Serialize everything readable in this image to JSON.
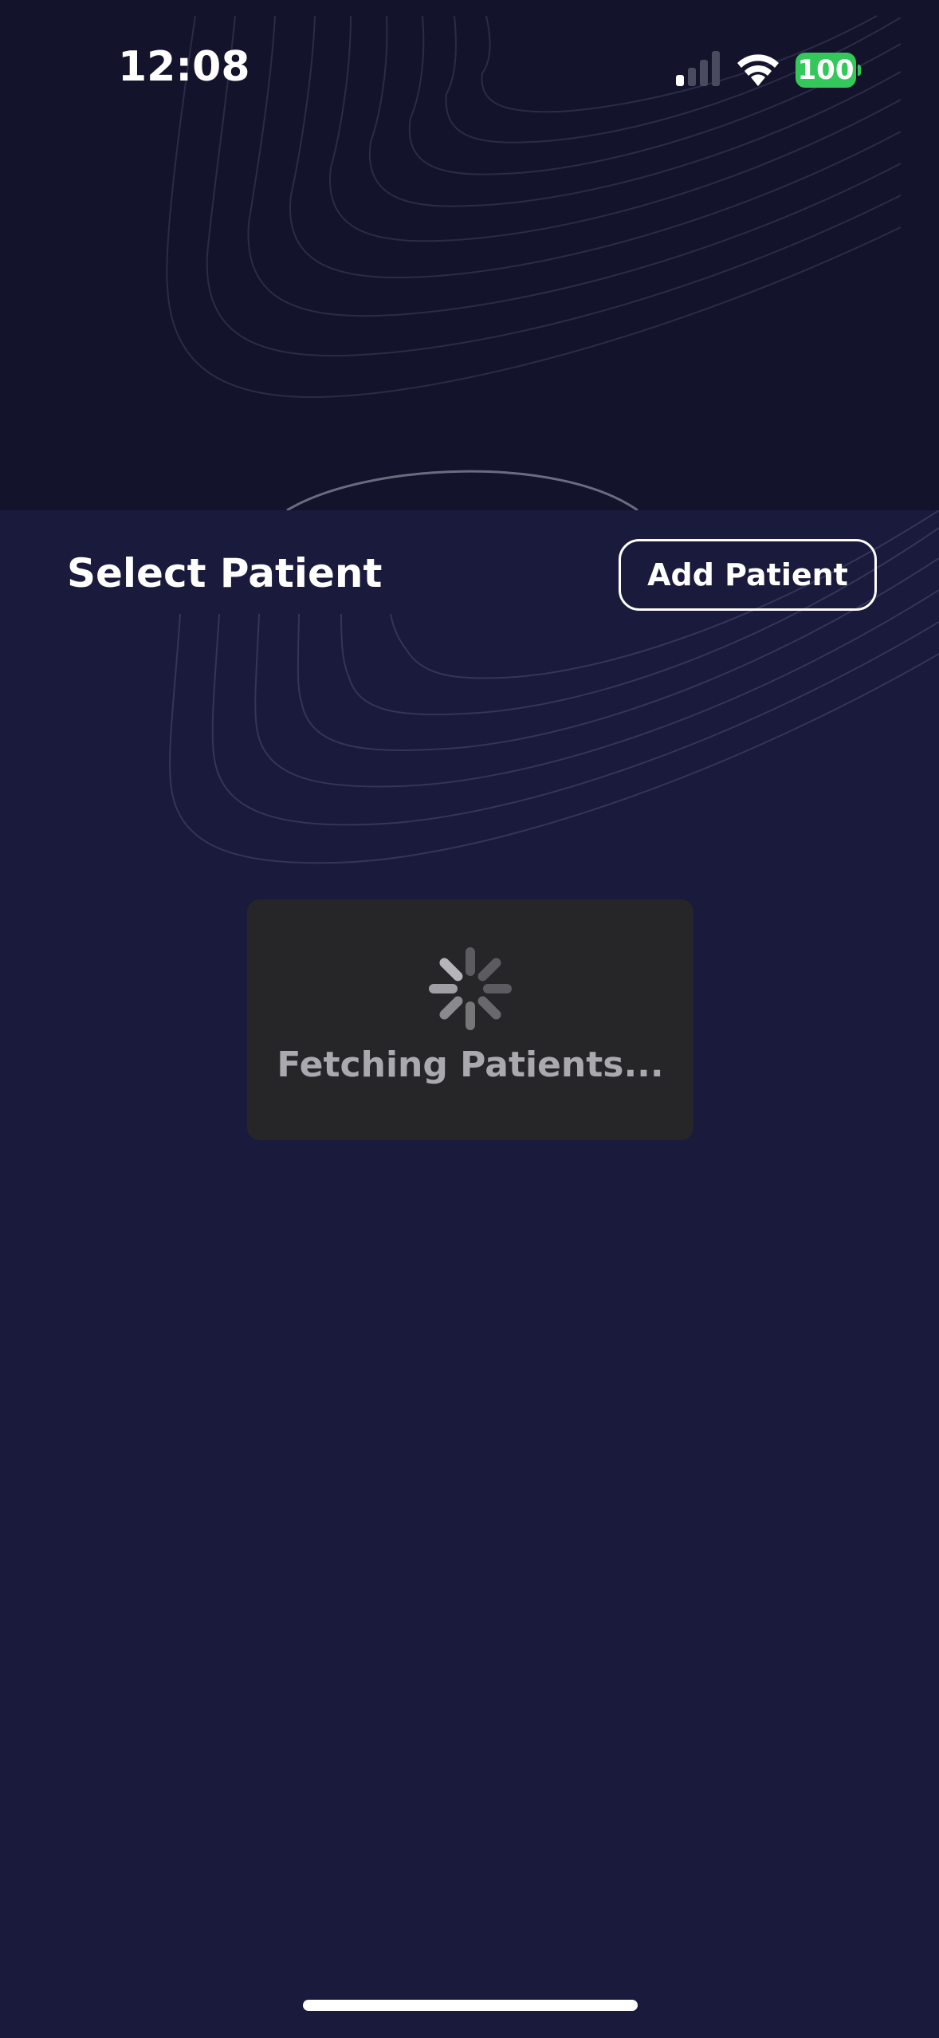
{
  "status_bar": {
    "time": "12:08",
    "battery_level": "100",
    "battery_color": "#34c759",
    "signal_bars_active": 1,
    "signal_bars_total": 4
  },
  "header": {
    "title": "Select Patient",
    "add_button_label": "Add Patient"
  },
  "loading": {
    "message": "Fetching Patients..."
  },
  "icons": {
    "signal": "cellular-signal-icon",
    "wifi": "wifi-icon",
    "battery": "battery-icon",
    "spinner": "activity-spinner-icon"
  },
  "colors": {
    "background": "#191a3c",
    "top_background": "#13142b",
    "card_background": "#262629",
    "text_primary": "#ffffff",
    "text_muted": "#a9a9ae"
  }
}
